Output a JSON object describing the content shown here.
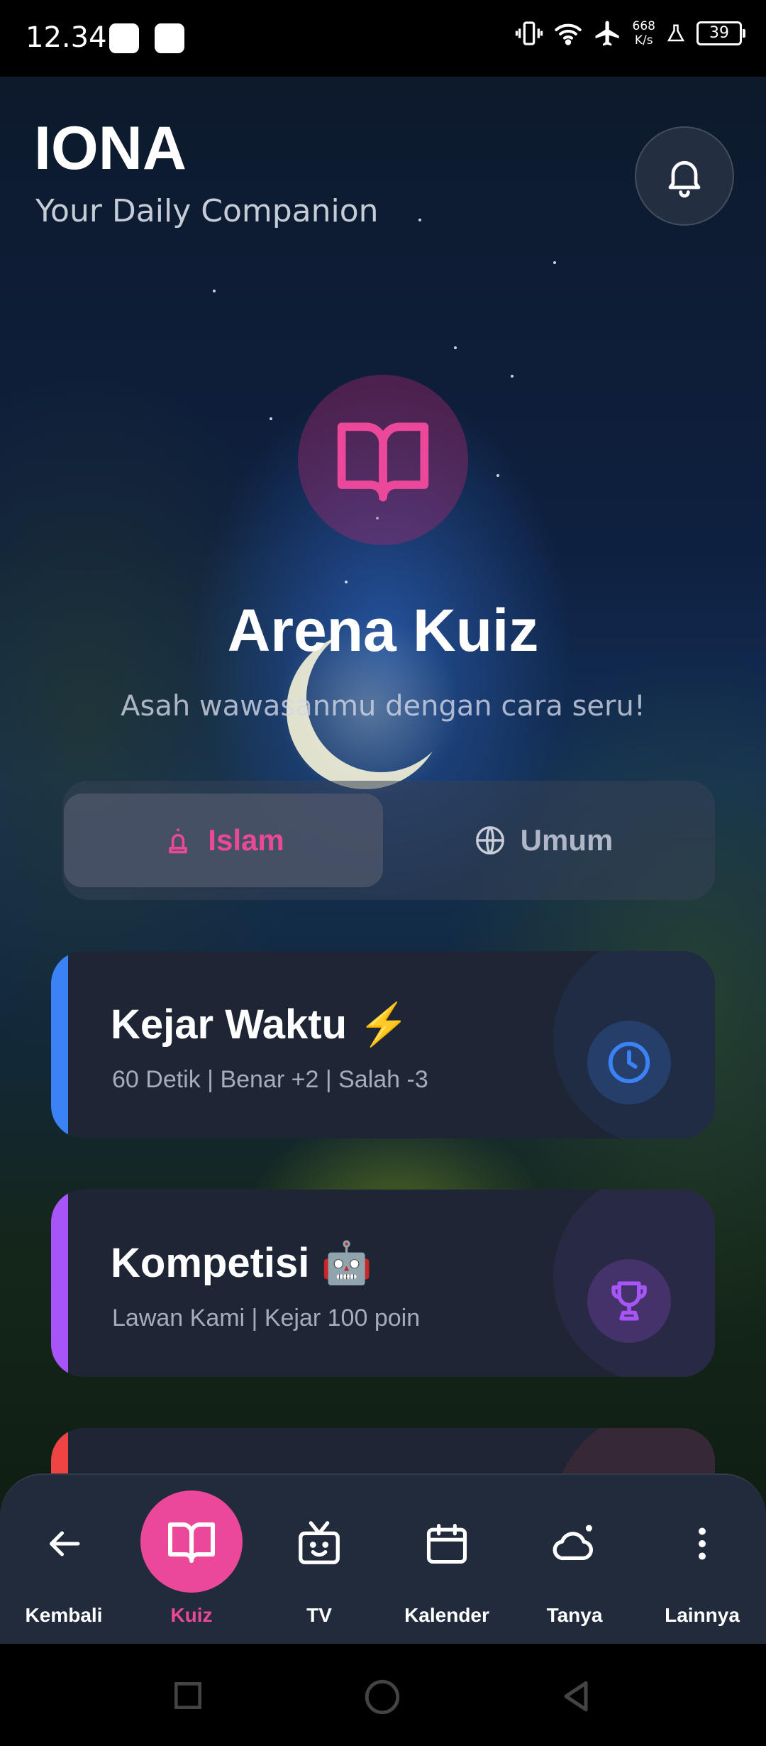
{
  "status_bar": {
    "time": "12.34",
    "net_speed_value": "668",
    "net_speed_unit": "K/s",
    "battery": "39"
  },
  "header": {
    "title": "IONA",
    "subtitle": "Your Daily Companion"
  },
  "hero": {
    "title": "Arena Kuiz",
    "subtitle": "Asah wawasanmu dengan cara seru!"
  },
  "tabs": [
    {
      "label": "Islam",
      "icon": "mosque-bell-icon"
    },
    {
      "label": "Umum",
      "icon": "globe-icon"
    }
  ],
  "cards": [
    {
      "title": "Kejar Waktu ⚡",
      "subtitle": "60 Detik | Benar +2 | Salah -3",
      "accent": "#3b82f6",
      "icon": "clock-icon"
    },
    {
      "title": "Kompetisi 🤖",
      "subtitle": "Lawan Kami | Kejar 100 poin",
      "accent": "#a855f7",
      "icon": "trophy-icon"
    },
    {
      "title": "",
      "subtitle": "",
      "accent": "#ef4444",
      "icon": ""
    }
  ],
  "bottom_nav": [
    {
      "label": "Kembali",
      "icon": "back-arrow-icon"
    },
    {
      "label": "Kuiz",
      "icon": "book-icon",
      "active": true
    },
    {
      "label": "TV",
      "icon": "tv-icon"
    },
    {
      "label": "Kalender",
      "icon": "calendar-icon"
    },
    {
      "label": "Tanya",
      "icon": "chat-cloud-icon"
    },
    {
      "label": "Lainnya",
      "icon": "more-vertical-icon"
    }
  ],
  "colors": {
    "accent_pink": "#ec4899",
    "card_bg": "#1e2535",
    "nav_bg": "#222b3c"
  }
}
